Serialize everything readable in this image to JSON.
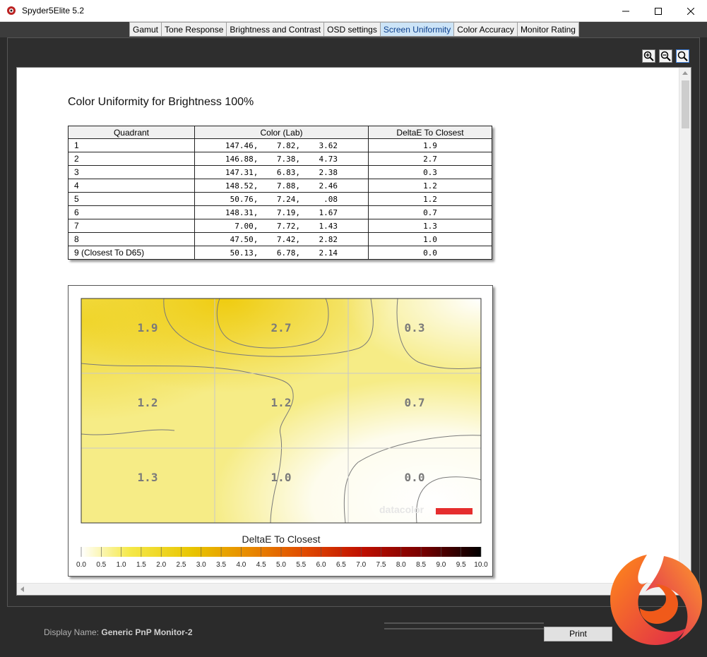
{
  "window": {
    "title": "Spyder5Elite 5.2"
  },
  "tabs": [
    {
      "label": "Gamut"
    },
    {
      "label": "Tone Response"
    },
    {
      "label": "Brightness and Contrast"
    },
    {
      "label": "OSD settings"
    },
    {
      "label": "Screen Uniformity",
      "active": true
    },
    {
      "label": "Color Accuracy"
    },
    {
      "label": "Monitor Rating"
    }
  ],
  "report": {
    "title": "Color Uniformity for Brightness 100%",
    "table": {
      "headers": [
        "Quadrant",
        "Color (Lab)",
        "DeltaE To Closest"
      ],
      "rows": [
        {
          "quadrant": "1",
          "lab": "147.46,    7.82,    3.62",
          "deltae": "1.9"
        },
        {
          "quadrant": "2",
          "lab": "146.88,    7.38,    4.73",
          "deltae": "2.7"
        },
        {
          "quadrant": "3",
          "lab": "147.31,    6.83,    2.38",
          "deltae": "0.3"
        },
        {
          "quadrant": "4",
          "lab": "148.52,    7.88,    2.46",
          "deltae": "1.2"
        },
        {
          "quadrant": "5",
          "lab": " 50.76,    7.24,     .08",
          "deltae": "1.2"
        },
        {
          "quadrant": "6",
          "lab": "148.31,    7.19,    1.67",
          "deltae": "0.7"
        },
        {
          "quadrant": "7",
          "lab": "  7.00,    7.72,    1.43",
          "deltae": "1.3"
        },
        {
          "quadrant": "8",
          "lab": " 47.50,    7.42,    2.82",
          "deltae": "1.0"
        },
        {
          "quadrant": "9 (Closest To D65)",
          "lab": " 50.13,    6.78,    2.14",
          "deltae": "0.0"
        }
      ]
    }
  },
  "chart_data": {
    "type": "heatmap",
    "grid": [
      [
        1.9,
        2.7,
        0.3
      ],
      [
        1.2,
        1.2,
        0.7
      ],
      [
        1.3,
        1.0,
        0.0
      ]
    ],
    "colorbar_title": "DeltaE To Closest",
    "colorbar_ticks": [
      "0.0",
      "0.5",
      "1.0",
      "1.5",
      "2.0",
      "2.5",
      "3.0",
      "3.5",
      "4.0",
      "4.5",
      "5.0",
      "5.5",
      "6.0",
      "6.5",
      "7.0",
      "7.5",
      "8.0",
      "8.5",
      "9.0",
      "9.5",
      "10.0"
    ],
    "range": [
      0,
      10
    ],
    "colors": [
      "#ffffff",
      "#f5e94a",
      "#e8c400",
      "#e88a00",
      "#e04a00",
      "#c01000",
      "#7a0000",
      "#000000"
    ],
    "watermark": "datacolor"
  },
  "footer": {
    "display_label": "Display Name:",
    "display_value": "Generic PnP Monitor-2",
    "print_label": "Print"
  }
}
